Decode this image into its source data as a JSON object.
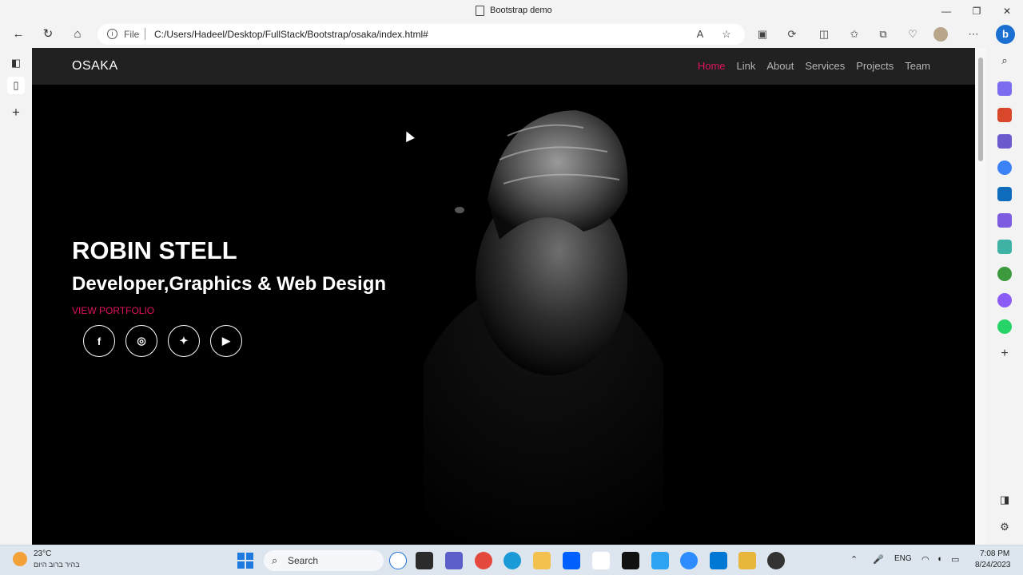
{
  "window": {
    "title": "Bootstrap demo",
    "controls": [
      "—",
      "❐",
      "✕"
    ]
  },
  "addressbar": {
    "file_label": "File",
    "url": "C:/Users/Hadeel/Desktop/FullStack/Bootstrap/osaka/index.html#"
  },
  "site": {
    "brand": "OSAKA",
    "menu": [
      "Home",
      "Link",
      "About",
      "Services",
      "Projects",
      "Team"
    ],
    "active_menu": "Home",
    "hero_name": "ROBIN STELL",
    "hero_role": "Developer,Graphics & Web Design",
    "hero_link": "VIEW PORTFOLIO",
    "socials": [
      {
        "icon": "facebook-icon",
        "glyph": "f"
      },
      {
        "icon": "instagram-icon",
        "glyph": "◎"
      },
      {
        "icon": "twitter-icon",
        "glyph": "✦"
      },
      {
        "icon": "youtube-icon",
        "glyph": "▶"
      }
    ],
    "accent_color": "#e0115f"
  },
  "taskbar": {
    "weather_temp": "23°C",
    "weather_desc": "בהיר ברוב היום",
    "search_label": "Search",
    "lang": "ENG",
    "time": "7:08 PM",
    "date": "8/24/2023"
  }
}
